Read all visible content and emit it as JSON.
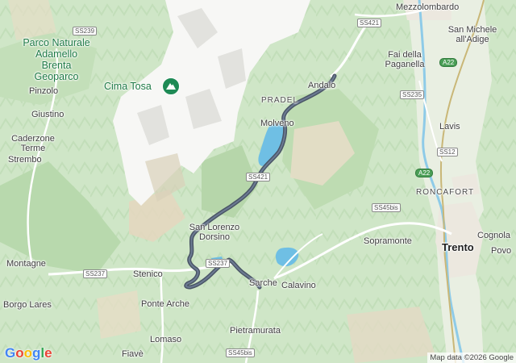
{
  "map": {
    "route_color": "#4a5566",
    "water_color": "#7cc5e8",
    "place_labels": {
      "mezzolombardo": "Mezzolombardo",
      "san_michele_1": "San Michele",
      "san_michele_2": "all'Adige",
      "fai_1": "Fai della",
      "fai_2": "Paganella",
      "andalo": "Andalo",
      "pradel": "PRADEL",
      "molveno": "Molveno",
      "lavis": "Lavis",
      "roncafort": "RONCAFORT",
      "cognola": "Cognola",
      "trento": "Trento",
      "povo": "Povo",
      "sopramonte": "Sopramonte",
      "calavino": "Calavino",
      "sarche": "Sarche",
      "pietramurata": "Pietramurata",
      "san_lorenzo": "San Lorenzo",
      "dorsino": "Dorsino",
      "stenico": "Stenico",
      "ponte_arche": "Ponte Arche",
      "lomaso": "Lomaso",
      "fiave": "Fiavè",
      "borgo_lares": "Borgo Lares",
      "montagne": "Montagne",
      "strembo": "Strembo",
      "caderzone_1": "Caderzone",
      "caderzone_2": "Terme",
      "giustino": "Giustino",
      "pinzolo": "Pinzolo"
    },
    "park_lines": [
      "Parco Naturale",
      "Adamello",
      "Brenta",
      "Geoparco"
    ],
    "peak": "Cima Tosa",
    "shields": {
      "ss239": "SS239",
      "ss421_top": "SS421",
      "ss235": "SS235",
      "a22_top": "A22",
      "ss12": "SS12",
      "a22_mid": "A22",
      "ss421_mid": "SS421",
      "ss45bis_mid": "SS45bis",
      "ss237_left": "SS237",
      "ss237_route": "SS237",
      "ss45bis_bottom": "SS45bis"
    },
    "attribution": "Map data ©2026 Google",
    "logo_letters": [
      "G",
      "o",
      "o",
      "g",
      "l",
      "e"
    ],
    "logo_colors": [
      "#4285F4",
      "#EA4335",
      "#FBBC05",
      "#4285F4",
      "#34A853",
      "#EA4335"
    ]
  }
}
